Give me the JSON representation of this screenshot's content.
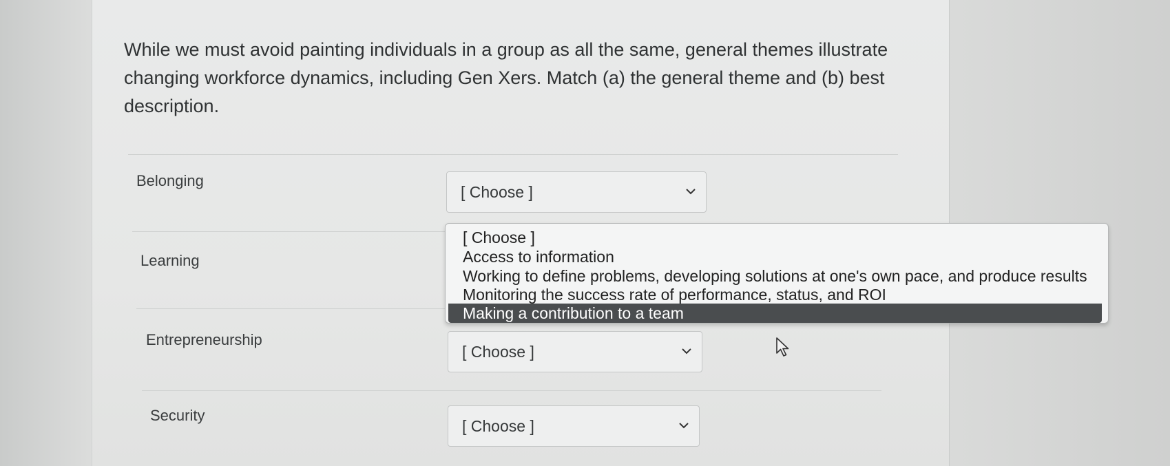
{
  "question": {
    "text": "While we must avoid painting individuals in a group as all the same, general themes illustrate\nchanging workforce dynamics, including Gen Xers. Match (a) the general theme and (b) best\ndescription."
  },
  "rows": [
    {
      "label": "Belonging",
      "selected": "[ Choose ]"
    },
    {
      "label": "Learning",
      "selected": ""
    },
    {
      "label": "Entrepreneurship",
      "selected": "[ Choose ]"
    },
    {
      "label": "Security",
      "selected": "[ Choose ]"
    }
  ],
  "dropdown": {
    "options": [
      "[ Choose ]",
      "Access to information",
      "Working to define problems, developing solutions at one's own pace, and produce results",
      "Monitoring the success rate of performance, status, and ROI",
      "Making a contribution to a team"
    ],
    "highlighted": "Making a contribution to a team"
  },
  "icons": {
    "chevron": "chevron-down-icon",
    "cursor": "mouse-pointer-icon"
  },
  "colors": {
    "highlight_bg": "#4a4d4f",
    "highlight_text": "#ffffff"
  }
}
